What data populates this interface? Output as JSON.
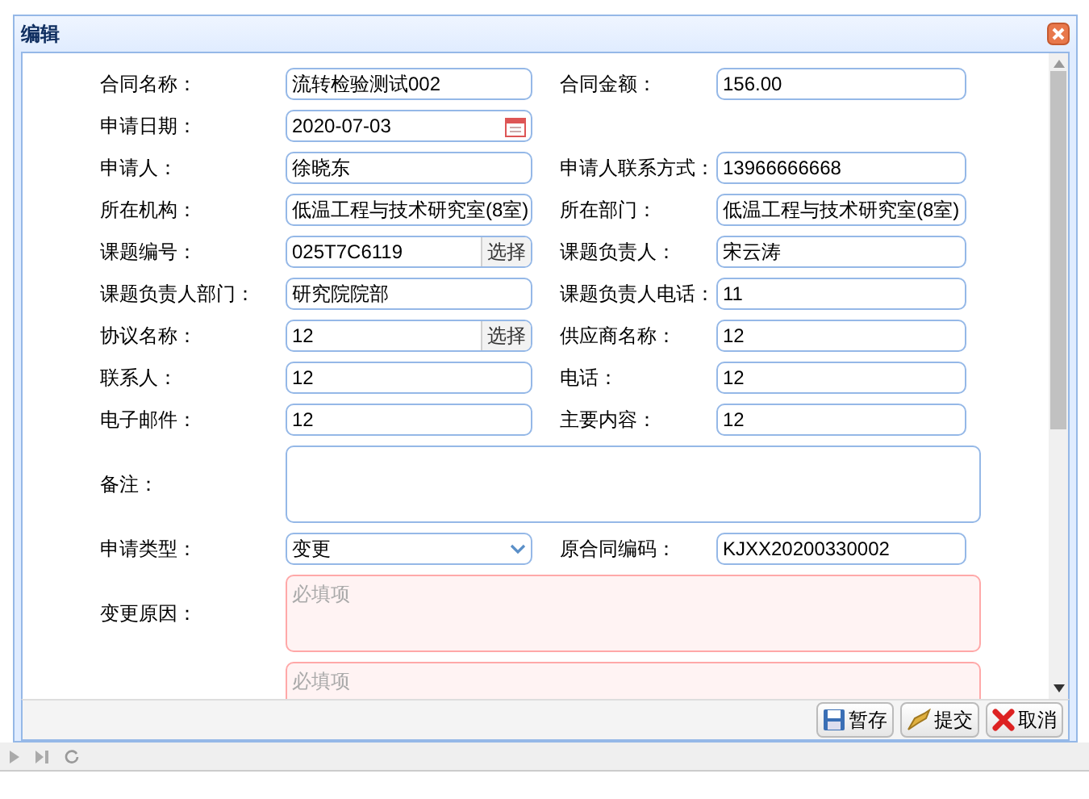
{
  "dialog": {
    "title": "编辑"
  },
  "rows": [
    {
      "fields": [
        {
          "label": "合同名称：",
          "kind": "text",
          "value": "流转检验测试002"
        },
        {
          "label": "合同金额：",
          "kind": "text",
          "value": "156.00"
        }
      ]
    },
    {
      "fields": [
        {
          "label": "申请日期：",
          "kind": "date",
          "value": "2020-07-03"
        }
      ]
    },
    {
      "fields": [
        {
          "label": "申请人：",
          "kind": "text",
          "value": "徐晓东"
        },
        {
          "label": "申请人联系方式：",
          "kind": "text",
          "value": "13966666668"
        }
      ]
    },
    {
      "fields": [
        {
          "label": "所在机构：",
          "kind": "text",
          "value": "低温工程与技术研究室(8室)"
        },
        {
          "label": "所在部门：",
          "kind": "text",
          "value": "低温工程与技术研究室(8室)"
        }
      ]
    },
    {
      "fields": [
        {
          "label": "课题编号：",
          "kind": "picker",
          "value": "025T7C6119",
          "button": "选择"
        },
        {
          "label": "课题负责人：",
          "kind": "text",
          "value": "宋云涛"
        }
      ]
    },
    {
      "fields": [
        {
          "label": "课题负责人部门：",
          "kind": "text",
          "value": "研究院院部"
        },
        {
          "label": "课题负责人电话：",
          "kind": "text",
          "value": "11"
        }
      ]
    },
    {
      "fields": [
        {
          "label": "协议名称：",
          "kind": "picker",
          "value": "12",
          "button": "选择"
        },
        {
          "label": "供应商名称：",
          "kind": "text",
          "value": "12"
        }
      ]
    },
    {
      "fields": [
        {
          "label": "联系人：",
          "kind": "text",
          "value": "12"
        },
        {
          "label": "电话：",
          "kind": "text",
          "value": "12"
        }
      ]
    },
    {
      "fields": [
        {
          "label": "电子邮件：",
          "kind": "text",
          "value": "12"
        },
        {
          "label": "主要内容：",
          "kind": "text",
          "value": "12"
        }
      ]
    },
    {
      "fields": [
        {
          "label": "备注：",
          "kind": "textarea",
          "required": false
        }
      ]
    },
    {
      "fields": [
        {
          "label": "申请类型：",
          "kind": "select",
          "value": "变更"
        },
        {
          "label": "原合同编码：",
          "kind": "text",
          "value": "KJXX20200330002"
        }
      ]
    },
    {
      "fields": [
        {
          "label": "变更原因：",
          "kind": "textarea",
          "required": true,
          "placeholder": "必填项"
        }
      ]
    },
    {
      "fields": [
        {
          "kind": "textarea",
          "required": true,
          "placeholder": "必填项"
        }
      ]
    }
  ],
  "buttons": [
    {
      "kind": "save",
      "label": "暂存"
    },
    {
      "kind": "submit",
      "label": "提交"
    },
    {
      "kind": "cancel",
      "label": "取消"
    }
  ]
}
